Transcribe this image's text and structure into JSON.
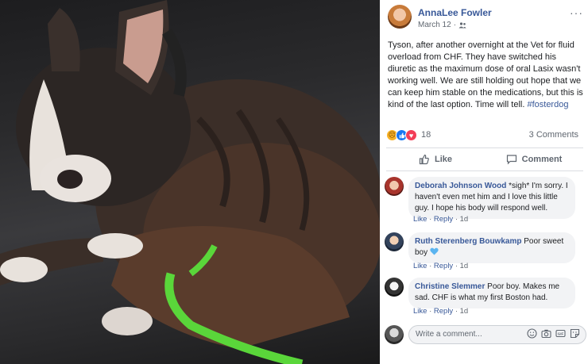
{
  "post": {
    "author": "AnnaLee Fowler",
    "date": "March 12",
    "date_separator": "·",
    "more_label": "···",
    "text_main": "Tyson, after another overnight at the Vet for fluid overload from CHF. They have switched his diuretic as the maximum dose of oral Lasix wasn't working well. We are still holding out hope that we can keep him stable on the medications, but this is kind of the last option. Time will tell. ",
    "hashtag": "#fosterdog"
  },
  "reactions": {
    "icons": [
      "sad-icon",
      "like-icon",
      "love-icon"
    ],
    "count": "18",
    "comments_label": "3 Comments"
  },
  "actions": {
    "like_label": "Like",
    "comment_label": "Comment"
  },
  "comments": [
    {
      "author": "Deborah Johnson Wood",
      "text": " *sigh* I'm sorry. I haven't even met him and I love this little guy. I hope his body will respond well.",
      "like": "Like",
      "reply": "Reply",
      "sep": " · ",
      "time": "1d"
    },
    {
      "author": "Ruth Sterenberg Bouwkamp",
      "text": " Poor sweet boy ",
      "emoji": "blue-heart-icon",
      "like": "Like",
      "reply": "Reply",
      "sep": " · ",
      "time": "1d"
    },
    {
      "author": "Christine Slemmer",
      "text": " Poor boy. Makes me sad. CHF is what my first Boston had.",
      "like": "Like",
      "reply": "Reply",
      "sep": " · ",
      "time": "1d"
    }
  ],
  "composer": {
    "placeholder": "Write a comment...",
    "icons": [
      "emoji-icon",
      "camera-icon",
      "gif-icon",
      "sticker-icon"
    ]
  },
  "colors": {
    "link": "#385898",
    "leash_green": "#5ad63a",
    "like_blue": "#1877f2",
    "love_red": "#f33e58",
    "sad_yellow": "#f7b125"
  }
}
